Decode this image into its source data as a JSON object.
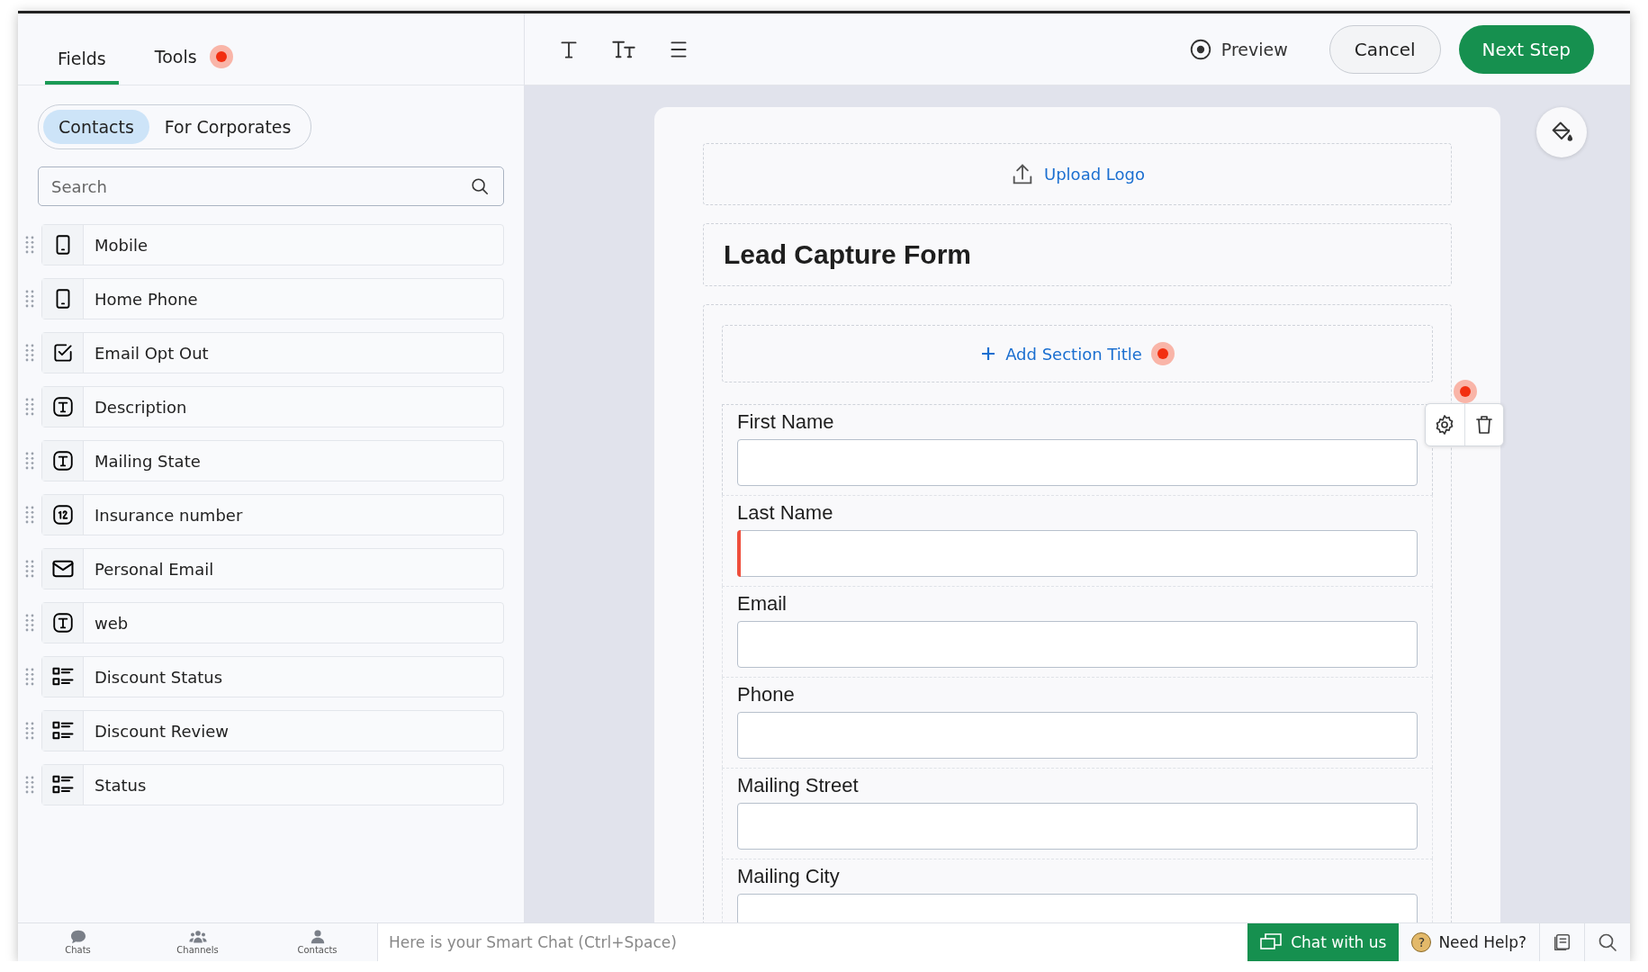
{
  "sidebar": {
    "tabs": [
      {
        "label": "Fields",
        "selected": true,
        "marker": false
      },
      {
        "label": "Tools",
        "selected": false,
        "marker": true
      }
    ],
    "segments": [
      {
        "label": "Contacts",
        "selected": true
      },
      {
        "label": "For Corporates",
        "selected": false
      }
    ],
    "search": {
      "placeholder": "Search"
    },
    "fields": [
      {
        "label": "Mobile",
        "kind": "phone"
      },
      {
        "label": "Home Phone",
        "kind": "phone"
      },
      {
        "label": "Email Opt Out",
        "kind": "checkbox"
      },
      {
        "label": "Description",
        "kind": "text"
      },
      {
        "label": "Mailing State",
        "kind": "text"
      },
      {
        "label": "Insurance number",
        "kind": "number"
      },
      {
        "label": "Personal Email",
        "kind": "email"
      },
      {
        "label": "web",
        "kind": "text"
      },
      {
        "label": "Discount Status",
        "kind": "list"
      },
      {
        "label": "Discount Review",
        "kind": "list"
      },
      {
        "label": "Status",
        "kind": "list"
      }
    ]
  },
  "toolbar": {
    "preview": "Preview",
    "cancel": "Cancel",
    "next": "Next Step"
  },
  "form": {
    "upload_logo": "Upload Logo",
    "title": "Lead Capture Form",
    "add_section_title": "Add Section Title",
    "add_section_marker": true,
    "field_tools_marker": true,
    "fields": [
      {
        "label": "First Name",
        "highlighted": false
      },
      {
        "label": "Last Name",
        "highlighted": true
      },
      {
        "label": "Email",
        "highlighted": false
      },
      {
        "label": "Phone",
        "highlighted": false
      },
      {
        "label": "Mailing Street",
        "highlighted": false
      },
      {
        "label": "Mailing City",
        "highlighted": false
      }
    ]
  },
  "bottom_bar": {
    "nav": [
      {
        "label": "Chats",
        "kind": "chats"
      },
      {
        "label": "Channels",
        "kind": "channels"
      },
      {
        "label": "Contacts",
        "kind": "contacts"
      }
    ],
    "smart_chat": {
      "placeholder": "Here is your Smart Chat (Ctrl+Space)"
    },
    "chat_with_us": "Chat with us",
    "need_help": "Need Help?",
    "help_glyph": "?"
  }
}
